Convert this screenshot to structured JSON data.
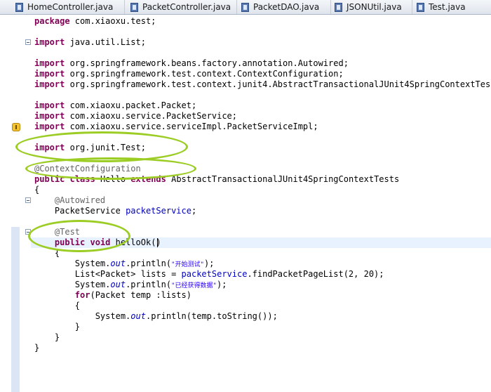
{
  "tabs": [
    {
      "label": "HomeController.java"
    },
    {
      "label": "PacketController.java"
    },
    {
      "label": "PacketDAO.java"
    },
    {
      "label": "JSONUtil.java"
    },
    {
      "label": "Test.java"
    }
  ],
  "code": {
    "package_kw": "package",
    "package_name": " com.xiaoxu.test;",
    "import_kw": "import",
    "imports": {
      "list": " java.util.List;",
      "autowired": " org.springframework.beans.factory.annotation.Autowired;",
      "context_config": " org.springframework.test.context.ContextConfiguration;",
      "abstract_tests": " org.springframework.test.context.junit4.AbstractTransactionalJUnit4SpringContextTests;",
      "packet": " com.xiaoxu.packet.Packet;",
      "packet_service": " com.xiaoxu.service.PacketService;",
      "packet_service_impl": " com.xiaoxu.service.serviceImpl.PacketServiceImpl;",
      "junit_test": " org.junit.Test;"
    },
    "ann_context": "@ContextConfiguration",
    "public_kw": "public",
    "class_kw": "class",
    "extends_kw": "extends",
    "class_name": " Hello ",
    "superclass": " AbstractTransactionalJUnit4SpringContextTests",
    "open_brace": "{",
    "close_brace": "}",
    "ann_autowired": "@Autowired",
    "field_type": "PacketService ",
    "field_name": "packetService",
    "semicolon": ";",
    "ann_test": "@Test",
    "void_kw": "void",
    "method_sig": " helloOk()",
    "system": "System.",
    "out": "out",
    "println_open": ".println(",
    "println_close": ");",
    "str_start": "\"开始测试\"",
    "str_done": "\"已经获得数据\"",
    "list_decl": "List<Packet> lists = ",
    "find_call": ".findPacketPageList(2, 20);",
    "for_kw": "for",
    "for_rest": "(Packet temp :lists)",
    "println_temp": ".println(temp.toString());"
  },
  "colors": {
    "keyword": "#7f0055",
    "annotation": "#646464",
    "string": "#2a00ff",
    "field": "#0000c0",
    "highlight_ellipse": "#9ccd24"
  }
}
